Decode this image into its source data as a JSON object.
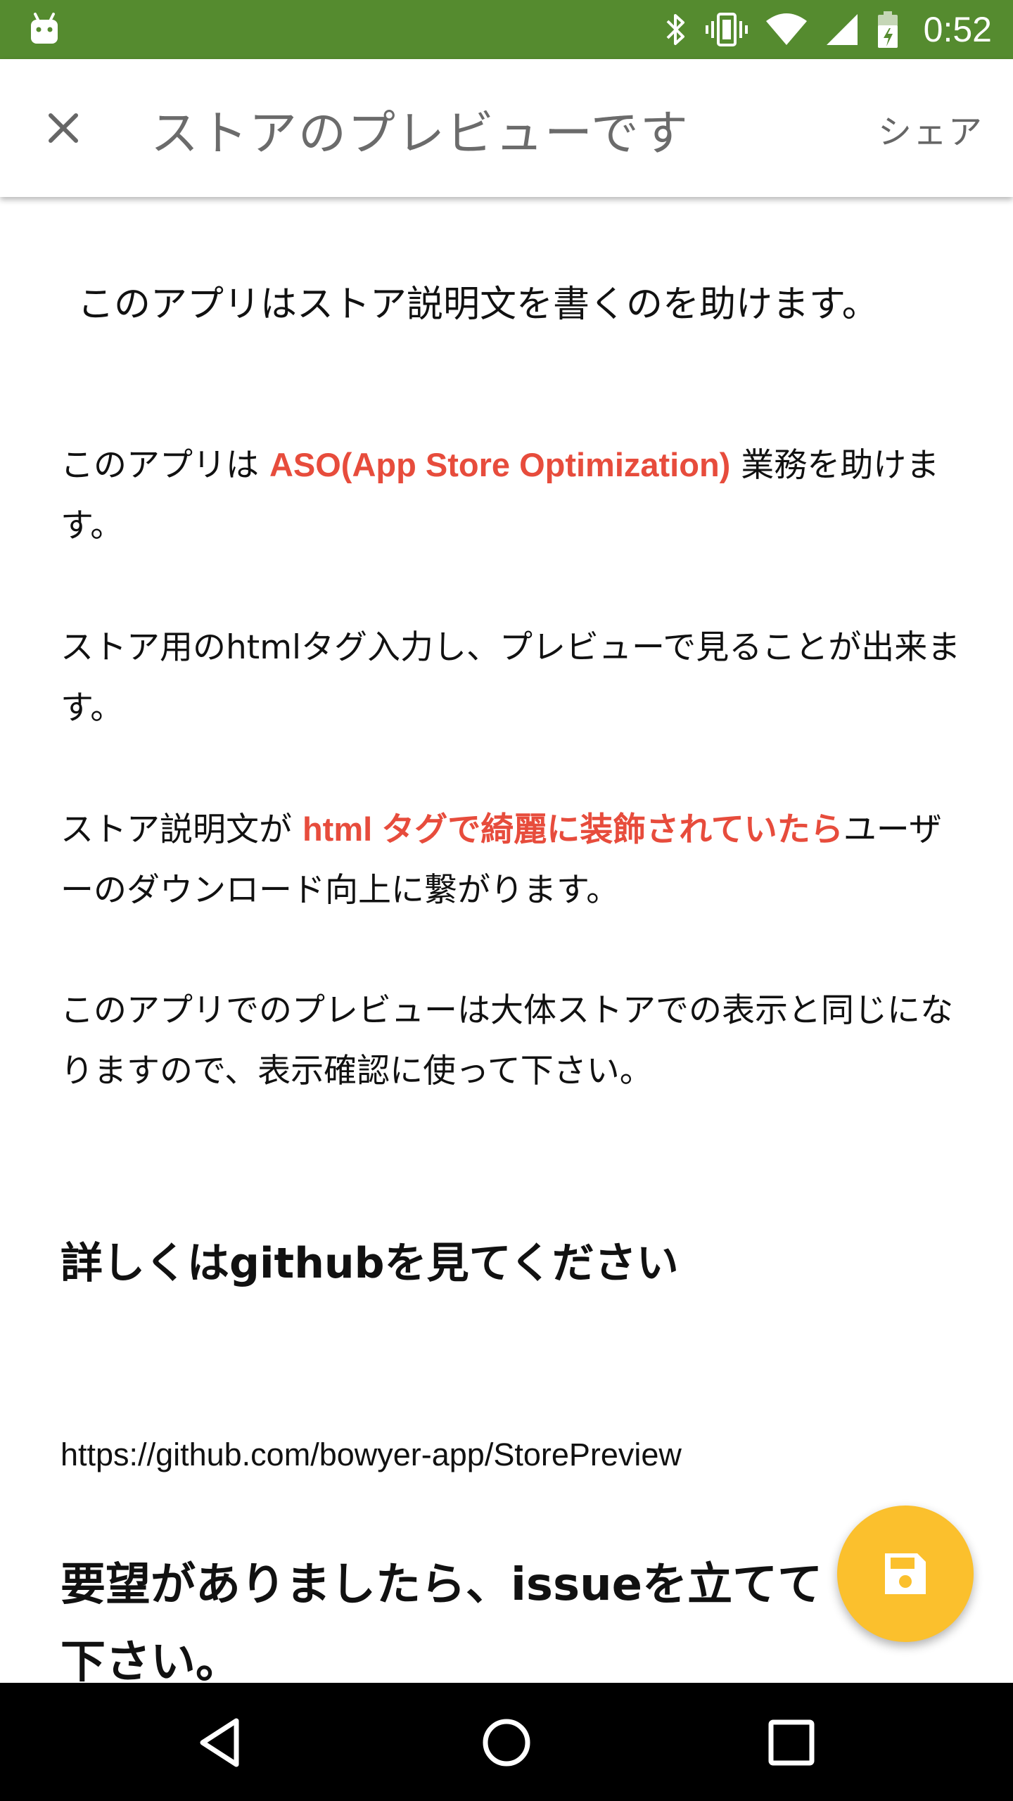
{
  "status_bar": {
    "time": "0:52",
    "bg_color": "#558b2f",
    "icons": [
      "android-icon",
      "bluetooth-icon",
      "vibrate-icon",
      "wifi-icon",
      "cell-signal-icon",
      "battery-icon"
    ]
  },
  "app_bar": {
    "close_icon": "close-icon",
    "title": "ストアのプレビューです",
    "share_label": "シェア"
  },
  "content": {
    "intro": "このアプリはストア説明文を書くのを助けます。",
    "p1": {
      "before": "このアプリは ",
      "accent": "ASO(App Store Optimization)",
      "after": " 業務を助けます。"
    },
    "p2": "ストア用のhtmlタグ入力し、プレビューで見ることが出来ます。",
    "p3": {
      "before": "ストア説明文が ",
      "accent": "html タグで綺麗に装飾されていたら",
      "after": "ユーザーのダウンロード向上に繋がります。"
    },
    "p4": "このアプリでのプレビューは大体ストアでの表示と同じになりますので、表示確認に使って下さい。",
    "heading": "詳しくはgithubを見てください",
    "url": "https://github.com/bowyer-app/StorePreview",
    "heading2": "要望がありましたら、issueを立てて下さい。",
    "accent_color": "#e74c3c"
  },
  "fab": {
    "icon": "save-icon",
    "color": "#fbc02d"
  },
  "nav_bar": {
    "icons": [
      "back-icon",
      "home-icon",
      "recents-icon"
    ]
  }
}
